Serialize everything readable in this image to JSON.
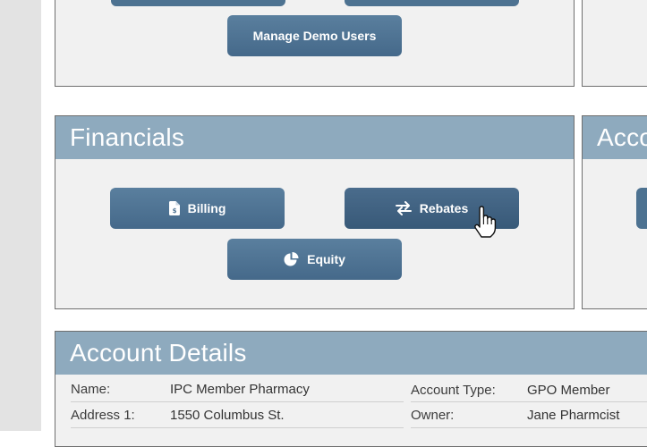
{
  "admin": {
    "manage_demo_users_label": "Manage Demo Users"
  },
  "financials": {
    "title": "Financials",
    "buttons": {
      "billing": "Billing",
      "rebates": "Rebates",
      "equity": "Equity"
    }
  },
  "right_panel": {
    "title_partial": "Acco"
  },
  "account_details": {
    "title": "Account Details",
    "rows": [
      {
        "label": "Name:",
        "value": "IPC Member Pharmacy",
        "label2": "Account Type:",
        "value2": "GPO Member"
      },
      {
        "label": "Address 1:",
        "value": "1550 Columbus St.",
        "label2": "Owner:",
        "value2": "Jane Pharmcist"
      }
    ]
  },
  "colors": {
    "button": "#4d7291",
    "panel_header": "#8eaabe",
    "panel_bg": "#f1f1f1"
  }
}
